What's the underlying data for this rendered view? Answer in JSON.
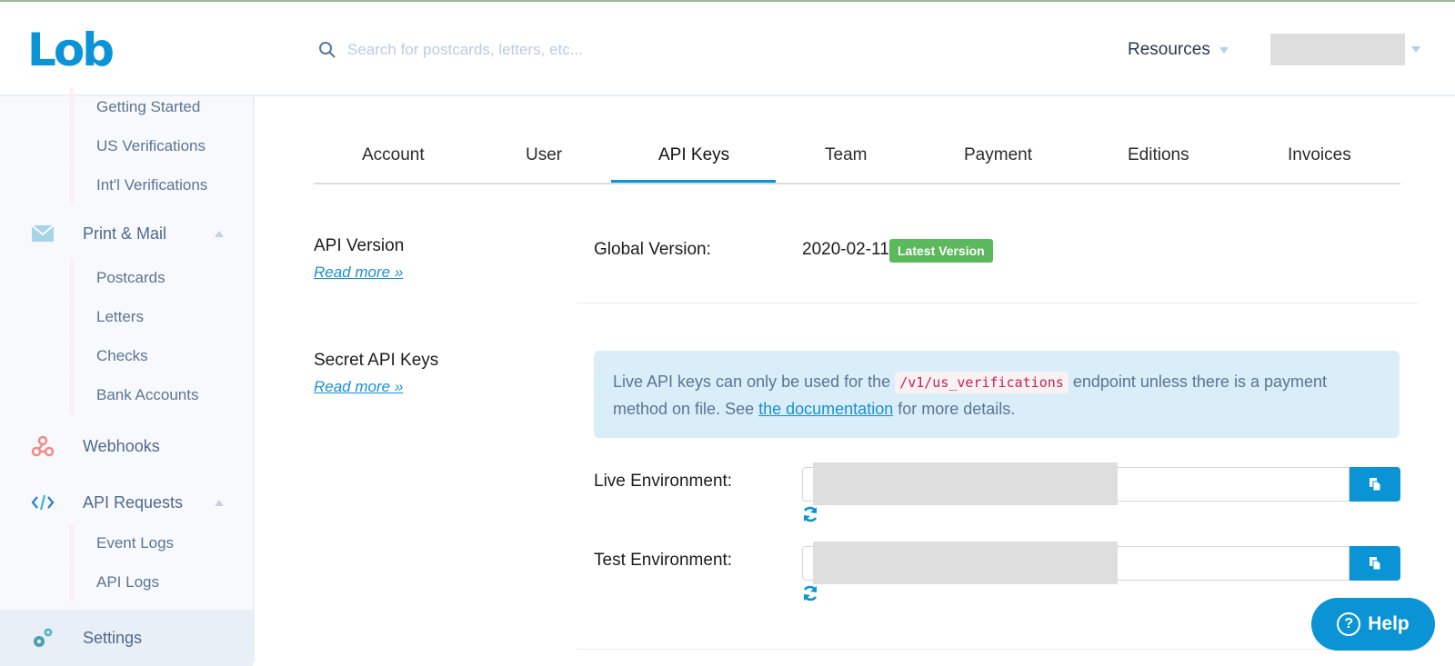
{
  "header": {
    "logo": "Lob",
    "search_placeholder": "Search for postcards, letters, etc...",
    "resources_label": "Resources"
  },
  "sidebar": {
    "address_sub": [
      "Getting Started",
      "US Verifications",
      "Int'l Verifications"
    ],
    "print_mail": {
      "label": "Print & Mail",
      "items": [
        "Postcards",
        "Letters",
        "Checks",
        "Bank Accounts"
      ]
    },
    "webhooks": {
      "label": "Webhooks"
    },
    "api_requests": {
      "label": "API Requests",
      "items": [
        "Event Logs",
        "API Logs"
      ]
    },
    "settings": {
      "label": "Settings"
    }
  },
  "tabs": [
    {
      "label": "Account",
      "active": false
    },
    {
      "label": "User",
      "active": false
    },
    {
      "label": "API Keys",
      "active": true
    },
    {
      "label": "Team",
      "active": false
    },
    {
      "label": "Payment",
      "active": false
    },
    {
      "label": "Editions",
      "active": false
    },
    {
      "label": "Invoices",
      "active": false
    }
  ],
  "api_version": {
    "title": "API Version",
    "read_more": "Read more »",
    "global_label": "Global Version:",
    "value": "2020-02-11",
    "badge": "Latest Version"
  },
  "secret_keys": {
    "title": "Secret API Keys",
    "read_more": "Read more »",
    "alert": {
      "text_before": "Live API keys can only be used for the ",
      "code": "/v1/us_verifications",
      "text_middle": " endpoint unless there is a payment method on file. See ",
      "link": "the documentation",
      "text_after": " for more details."
    },
    "live_label": "Live Environment:",
    "test_label": "Test Environment:"
  },
  "help_label": "Help",
  "colors": {
    "brand": "#0a94d6",
    "badge": "#5cb85c",
    "alert_bg": "#d9eef8",
    "code": "#c7254e"
  }
}
